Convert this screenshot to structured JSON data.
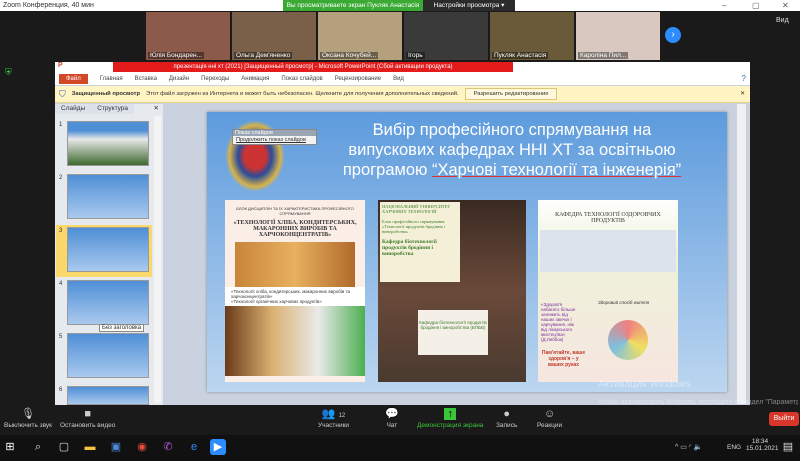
{
  "zoom": {
    "title": "Zoom Конференция, 40 мин",
    "banner": "Вы просматриваете экран Пукляк Анастасія",
    "view_options": "Настройки просмотра ▾",
    "gallery": "Вид",
    "participants": [
      "Юлія Бондарен...",
      "Ольга Дем'яненко",
      "Оксана Кочубей...",
      "Ігорь",
      "Пукляк Анастасія",
      "Кароліна Пил..."
    ],
    "toolbar": {
      "mute": "Выключить звук",
      "video": "Остановить видео",
      "participants": "Участники",
      "participants_count": "12",
      "chat": "Чат",
      "share": "Демонстрация экрана",
      "record": "Запись",
      "reactions": "Реакции",
      "leave": "Выйти"
    }
  },
  "ppt": {
    "title": "презентація нні хт (2021) [Защищенный просмотр] - Microsoft PowerPoint (Сбой активации продукта)",
    "tabs": [
      "Файл",
      "Главная",
      "Вставка",
      "Дизайн",
      "Переходы",
      "Анимация",
      "Показ слайдов",
      "Рецензирование",
      "Вид"
    ],
    "protected": {
      "label": "Защищенный просмотр",
      "message": "Этот файл загружен из Интернета и может быть небезопасен. Щелкните для получения дополнительных сведений.",
      "button": "Разрешить редактирование"
    },
    "panel_tabs": [
      "Слайды",
      "Структура"
    ],
    "slide_numbers": [
      "1",
      "2",
      "3",
      "4",
      "5",
      "6"
    ],
    "tooltip": "Без заголовка",
    "slideshow_popup": {
      "title": "Показ слайдов",
      "item": "Продолжить показ слайдов"
    },
    "slide": {
      "title_line1": "Вибір професійного спрямування на",
      "title_line2": "випускових кафедрах ННІ ХТ за освітньою",
      "title_line3a": "програмою ",
      "title_line3b": "“Харчові технології та інженерія”",
      "card1": {
        "heading": "БЛОК ДИСЦИПЛІН ТА ЇХ ХАРАКТЕРИСТИКА ПРОФЕСІЙНОГО СПРЯМУВАННЯ",
        "title": "«ТЕХНОЛОГІЇ ХЛІБА, КОНДИТЕРСЬКИХ, МАКАРОННИХ ВИРОБІВ ТА ХАРЧОКОНЦЕНТРАТІВ»",
        "bullet1": "«Технології хліба, кондитерських, макаронних виробів та харчоконцентратів»",
        "bullet2": "«Технології органічних харчових продуктів»"
      },
      "card2": {
        "university": "НАЦІОНАЛЬНИЙ УНІВЕРСИТЕТ ХАРЧОВИХ ТЕХНОЛОГІЙ",
        "block": "Блок професійного спрямування «Технології продуктів бродіння і виноробства»",
        "dept": "Кафедра біотехнології продуктів бродіння і виноробства",
        "dept2": "Кафедра біотехнології продуктів бродіння і виноробства (БПБВ)"
      },
      "card3": {
        "title": "КАФЕДРА ТЕХНОЛОГІЇ ОЗДОРОВЧИХ ПРОДУКТІВ",
        "quote": "«Здоров'я набагато більше залежить від наших звичок і харчування, ніж від лікарського мистецтва» (Д.Леббок)",
        "motto": "Пам'ятайте, ваше здоров'я – у ваших руках",
        "diagram": "Здоровий спосіб життя"
      }
    }
  },
  "system": {
    "activation": "Активация Windows",
    "activation_sub": "Чтобы активировать Windows, перейдите в раздел \"Параметры\".",
    "lang": "ENG",
    "time": "18:34",
    "date": "15.01.2021"
  }
}
